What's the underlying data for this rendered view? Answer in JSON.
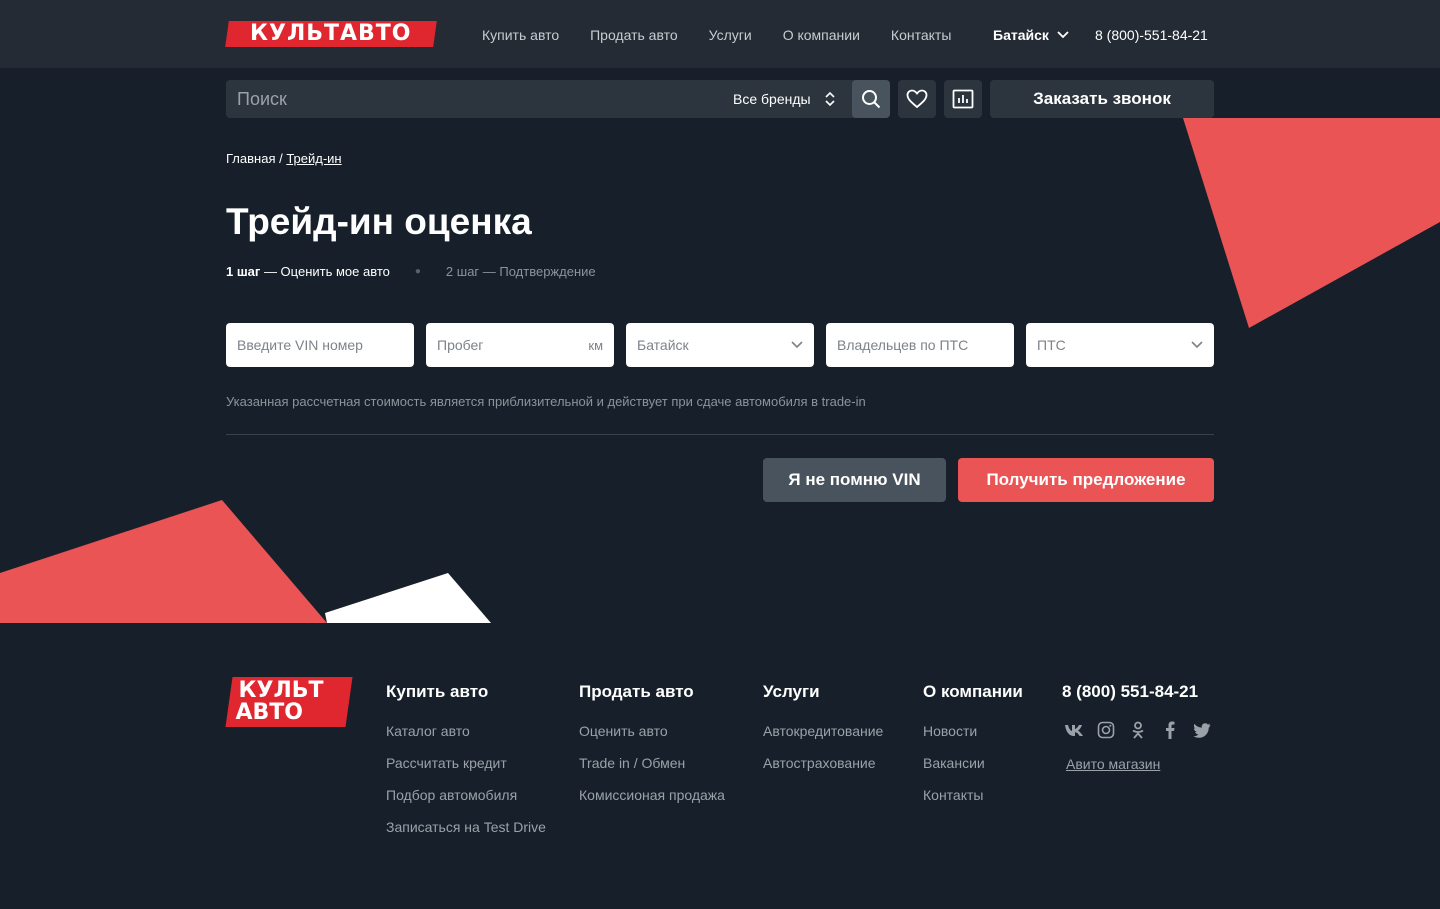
{
  "header": {
    "logo": "КУЛЬТАВТО",
    "nav": [
      "Купить авто",
      "Продать авто",
      "Услуги",
      "О компании",
      "Контакты"
    ],
    "city": "Батайск",
    "phone": "8 (800)-551-84-21"
  },
  "search": {
    "placeholder": "Поиск",
    "brands_select": "Все бренды",
    "callback_button": "Заказать звонок"
  },
  "breadcrumb": {
    "home": "Главная",
    "separator": " / ",
    "current": "Трейд-ин"
  },
  "page": {
    "title": "Трейд-ин оценка",
    "step1_num": "1 шаг",
    "step1_label": " — Оценить мое авто",
    "step2": "2 шаг  — Подтверждение"
  },
  "form": {
    "vin_placeholder": "Введите VIN номер",
    "mileage_placeholder": "Пробег",
    "mileage_unit": "км",
    "city_value": "Батайск",
    "owners_placeholder": "Владельцев по ПТС",
    "pts_value": "ПТС",
    "note": "Указанная рассчетная стоимость является приблизительной и действует при сдаче автомобиля в trade-in",
    "no_vin_button": "Я не помню VIN",
    "submit_button": "Получить предложение"
  },
  "footer": {
    "logo_line1": "КУЛЬТ",
    "logo_line2": "АВТО",
    "columns": [
      {
        "title": "Купить авто",
        "links": [
          "Каталог авто",
          "Рассчитать кредит",
          "Подбор автомобиля",
          "Записаться на Test Drive"
        ]
      },
      {
        "title": "Продать авто",
        "links": [
          "Оценить авто",
          "Trade in / Обмен",
          "Комиссионая продажа"
        ]
      },
      {
        "title": "Услуги",
        "links": [
          "Автокредитование",
          "Автострахование"
        ]
      },
      {
        "title": "О компании",
        "links": [
          "Новости",
          "Вакансии",
          "Контакты"
        ]
      }
    ],
    "phone": "8 (800) 551-84-21",
    "socials": [
      "vk-icon",
      "instagram-icon",
      "odnoklassniki-icon",
      "facebook-icon",
      "twitter-icon"
    ],
    "avito": "Авито магазин"
  },
  "colors": {
    "accent": "#ea5455",
    "logo_red": "#e0262f",
    "background": "#17202a",
    "header": "#242b34"
  }
}
